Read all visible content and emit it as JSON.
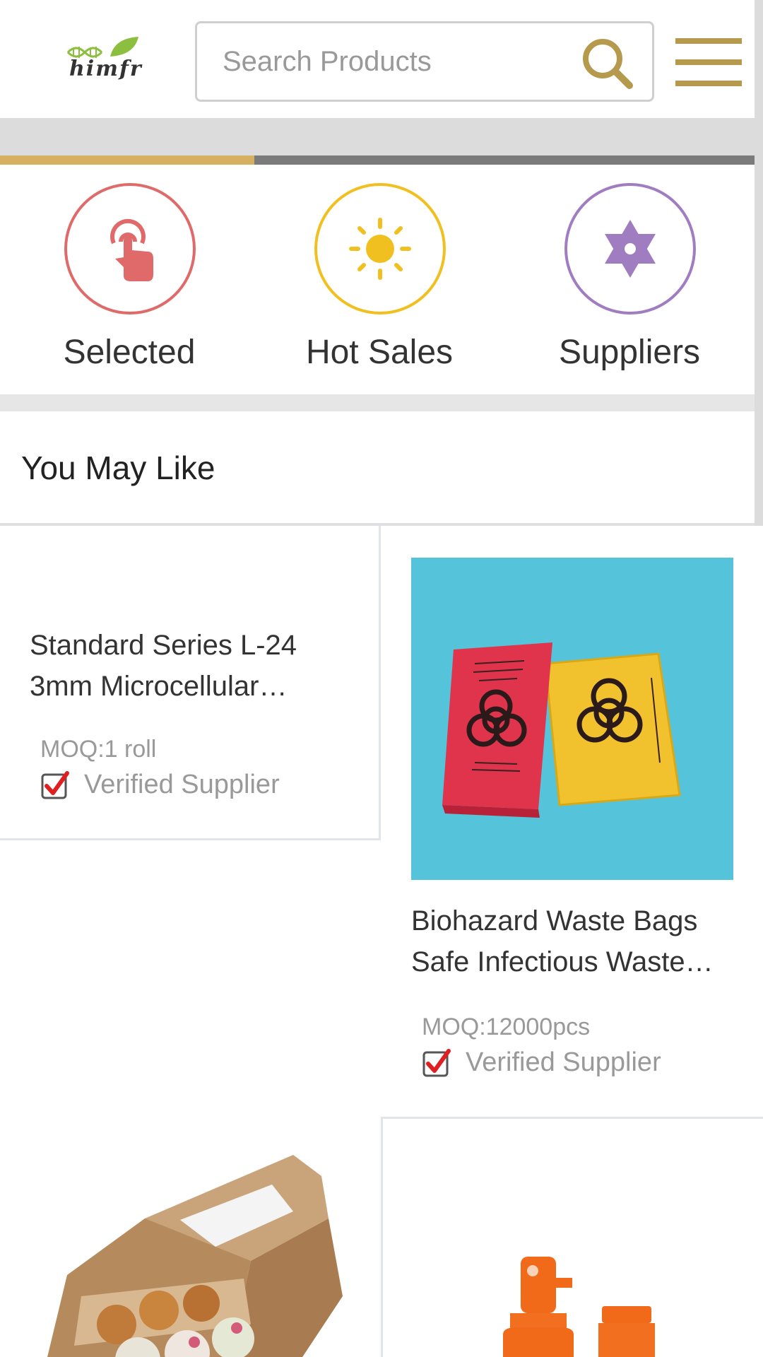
{
  "header": {
    "logo_text": "himfr",
    "search_placeholder": "Search Products"
  },
  "banner": {
    "progress": 0.333
  },
  "categories": [
    {
      "label": "Selected",
      "icon": "tap-hand-icon",
      "color": "#e06a6a"
    },
    {
      "label": "Hot Sales",
      "icon": "sun-icon",
      "color": "#f0c020"
    },
    {
      "label": "Suppliers",
      "icon": "star-of-david-icon",
      "color": "#a07cc0"
    }
  ],
  "section": {
    "title": "You May Like"
  },
  "products": [
    {
      "title_line1": "Standard Series L-24",
      "title_line2": "3mm Microcellular…",
      "moq": "MOQ:1 roll",
      "verified": "Verified Supplier"
    },
    {
      "title_line1": "Biohazard Waste Bags",
      "title_line2": "Safe Infectious Waste…",
      "moq": "MOQ:12000pcs",
      "verified": "Verified Supplier"
    }
  ],
  "colors": {
    "accent_gold": "#b59a4e",
    "progress_gold": "#d4b060",
    "check_red": "#e02020"
  }
}
